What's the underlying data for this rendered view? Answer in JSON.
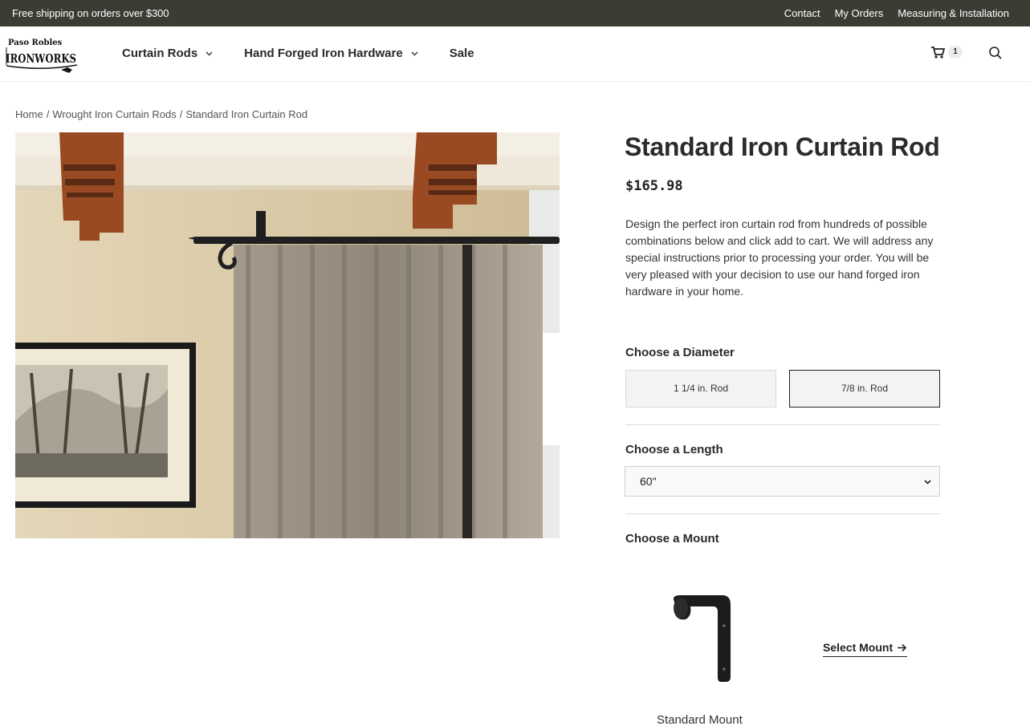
{
  "topbar": {
    "shipping": "Free shipping on orders over $300",
    "links": [
      "Contact",
      "My Orders",
      "Measuring & Installation"
    ]
  },
  "logo": {
    "line1": "Paso Robles",
    "line2": "IRONWORKS"
  },
  "nav": {
    "items": [
      {
        "label": "Curtain Rods",
        "dropdown": true
      },
      {
        "label": "Hand Forged Iron Hardware",
        "dropdown": true
      },
      {
        "label": "Sale",
        "dropdown": false
      }
    ]
  },
  "cart": {
    "icon": "cart-icon",
    "count": "1"
  },
  "search": {
    "icon": "search-icon"
  },
  "breadcrumb": [
    "Home",
    "Wrought Iron Curtain Rods",
    "Standard Iron Curtain Rod"
  ],
  "product": {
    "title": "Standard Iron Curtain Rod",
    "price": "$165.98",
    "description": "Design the perfect iron curtain rod from hundreds of possible combinations below and click add to cart. We will address any special instructions prior to processing your order. You will be very pleased with your decision to use our hand forged iron hardware in your home."
  },
  "diameter": {
    "label": "Choose a Diameter",
    "options": [
      "1 1/4 in. Rod",
      "7/8 in. Rod"
    ],
    "selected": "7/8 in. Rod"
  },
  "length": {
    "label": "Choose a Length",
    "value": "60\""
  },
  "mount": {
    "label": "Choose a Mount",
    "name": "Standard Mount",
    "action": "Select Mount"
  },
  "colors": {
    "topbar": "#3c3c34",
    "rod": "#1f1f1f",
    "curtain": "#9a9185",
    "wall": "#d8c9a7",
    "beam": "#9a4a22"
  }
}
